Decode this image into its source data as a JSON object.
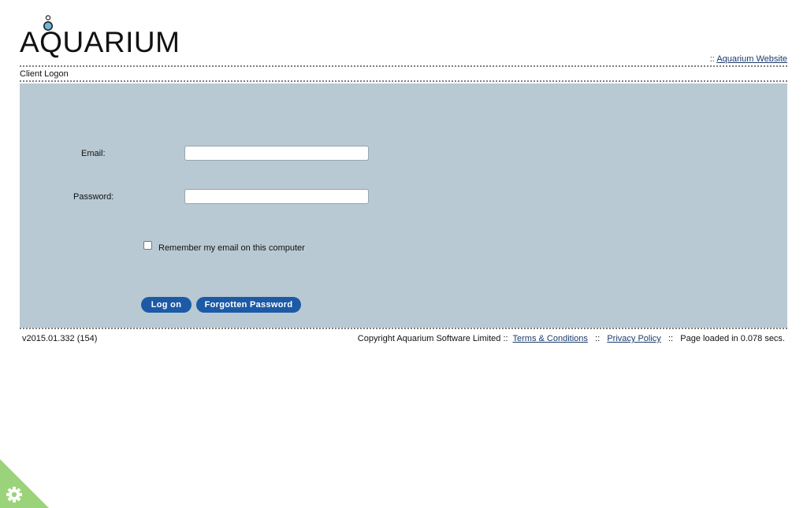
{
  "header": {
    "logo_text": "AQUARIUM",
    "top_link_prefix": "::",
    "website_link": "Aquarium Website",
    "breadcrumb": "Client Logon"
  },
  "form": {
    "email_label": "Email:",
    "email_value": "",
    "password_label": "Password:",
    "password_value": "",
    "remember_label": "Remember my email on this computer",
    "remember_checked": false,
    "logon_button": "Log on",
    "forgot_button": "Forgotten Password"
  },
  "footer": {
    "version": "v2015.01.332 (154)",
    "copyright": "Copyright Aquarium Software Limited",
    "sep1": "::",
    "terms_link": "Terms & Conditions",
    "sep2": "::",
    "privacy_link": "Privacy Policy",
    "sep3": "::",
    "load_time": "Page loaded in 0.078 secs."
  },
  "colors": {
    "panel_bg": "#b8c9d3",
    "button_bg": "#1d5aa6",
    "badge_green": "#9bd37a"
  },
  "icons": {
    "corner_badge": "gear-icon"
  }
}
